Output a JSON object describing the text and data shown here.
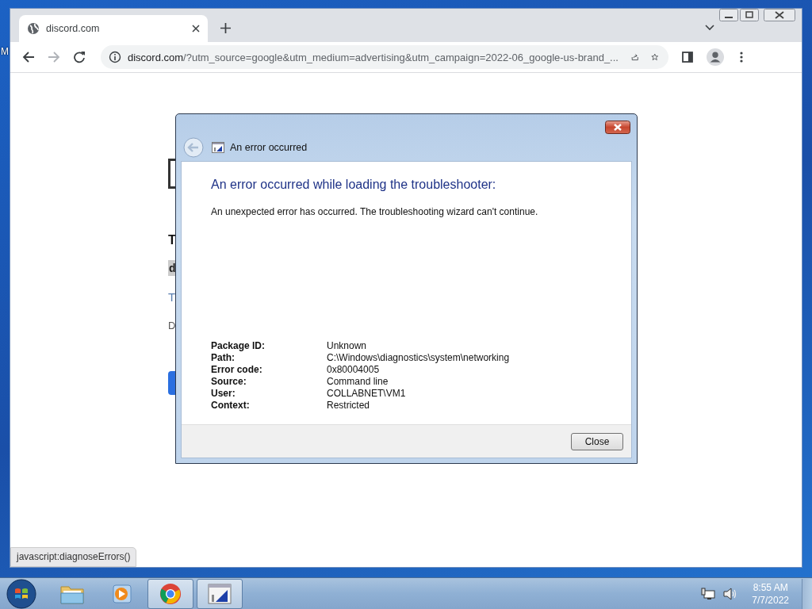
{
  "desktop": {
    "icon_label_fragment": "M"
  },
  "browser": {
    "tab": {
      "title": "discord.com"
    },
    "address": {
      "host": "discord.com",
      "rest": "/?utm_source=google&utm_medium=advertising&utm_campaign=2022-06_google-us-brand_..."
    },
    "page_fragments": [
      {
        "kind": "box"
      },
      {
        "kind": "heading",
        "text": "T"
      },
      {
        "kind": "chip",
        "text": "d"
      },
      {
        "kind": "link",
        "text": "T"
      },
      {
        "kind": "note",
        "text": "D"
      },
      {
        "kind": "button"
      }
    ],
    "status_url": "javascript:diagnoseErrors()"
  },
  "dialog": {
    "title": "An error occurred",
    "heading": "An error occurred while loading the troubleshooter:",
    "message": "An unexpected error has occurred. The troubleshooting wizard can't continue.",
    "details": [
      {
        "label": "Package ID:",
        "value": "Unknown"
      },
      {
        "label": "Path:",
        "value": "C:\\Windows\\diagnostics\\system\\networking"
      },
      {
        "label": "Error code:",
        "value": "0x80004005"
      },
      {
        "label": "Source:",
        "value": "Command line"
      },
      {
        "label": "User:",
        "value": "COLLABNET\\VM1"
      },
      {
        "label": "Context:",
        "value": "Restricted"
      }
    ],
    "buttons": [
      "Close"
    ]
  },
  "taskbar": {
    "items": [
      {
        "kind": "folder",
        "running": false
      },
      {
        "kind": "media",
        "running": false
      },
      {
        "kind": "browser",
        "running": true
      },
      {
        "kind": "window",
        "running": true
      }
    ],
    "clock": {
      "time": "8:55 AM",
      "date": "7/7/2022"
    }
  }
}
